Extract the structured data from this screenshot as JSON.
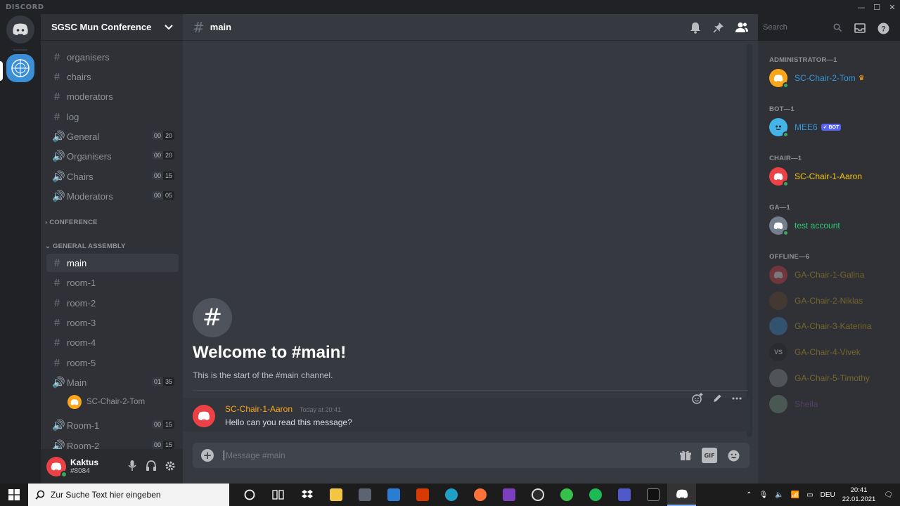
{
  "app": {
    "brand": "DISCORD"
  },
  "server": {
    "name": "SGSC Mun Conference"
  },
  "sidebar": {
    "channels_top": [
      {
        "label": "organisers",
        "type": "text"
      },
      {
        "label": "chairs",
        "type": "text"
      },
      {
        "label": "moderators",
        "type": "text"
      },
      {
        "label": "log",
        "type": "text"
      },
      {
        "label": "General",
        "type": "voice",
        "count_a": "00",
        "count_b": "20"
      },
      {
        "label": "Organisers",
        "type": "voice",
        "count_a": "00",
        "count_b": "20"
      },
      {
        "label": "Chairs",
        "type": "voice",
        "count_a": "00",
        "count_b": "15"
      },
      {
        "label": "Moderators",
        "type": "voice",
        "count_a": "00",
        "count_b": "05"
      }
    ],
    "category_conference": "CONFERENCE",
    "category_general_assembly": "GENERAL ASSEMBLY",
    "channels_ga": [
      {
        "label": "main",
        "type": "text",
        "active": true
      },
      {
        "label": "room-1",
        "type": "text"
      },
      {
        "label": "room-2",
        "type": "text"
      },
      {
        "label": "room-3",
        "type": "text"
      },
      {
        "label": "room-4",
        "type": "text"
      },
      {
        "label": "room-5",
        "type": "text"
      },
      {
        "label": "Main",
        "type": "voice",
        "count_a": "01",
        "count_b": "35"
      },
      {
        "label": "Room-1",
        "type": "voice",
        "count_a": "00",
        "count_b": "15"
      },
      {
        "label": "Room-2",
        "type": "voice",
        "count_a": "00",
        "count_b": "15"
      }
    ],
    "voice_user": "SC-Chair-2-Tom"
  },
  "user": {
    "name": "Kaktus",
    "tag": "#8084"
  },
  "chat": {
    "channel": "main",
    "welcome_title": "Welcome to #main!",
    "welcome_sub": "This is the start of the #main channel.",
    "message": {
      "author": "SC-Chair-1-Aaron",
      "time": "Today at 20:41",
      "text": "Hello can you read this message?"
    },
    "composer_placeholder": "Message #main"
  },
  "toolbar": {
    "search_placeholder": "Search",
    "gif_label": "GIF"
  },
  "members": {
    "roles": [
      {
        "label": "ADMINISTRATOR—1"
      },
      {
        "label": "BOT—1"
      },
      {
        "label": "CHAIR—1"
      },
      {
        "label": "GA—1"
      },
      {
        "label": "OFFLINE—6"
      }
    ],
    "online": [
      {
        "name": "SC-Chair-2-Tom",
        "color": "#3498db",
        "avatar": "#faa61a"
      },
      {
        "name": "MEE6",
        "color": "#3498db",
        "avatar": "#43b5e8",
        "badge": "✓ BOT"
      },
      {
        "name": "SC-Chair-1-Aaron",
        "color": "#f1c40f",
        "avatar": "#ed4245"
      },
      {
        "name": "test account",
        "color": "#2ecc71",
        "avatar": "#747f8d"
      }
    ],
    "offline": [
      {
        "name": "GA-Chair-1-Galina",
        "avatar": "#ed4245"
      },
      {
        "name": "GA-Chair-2-Niklas",
        "avatar": "#6b4a2b"
      },
      {
        "name": "GA-Chair-3-Katerina",
        "avatar": "#3a8fd6"
      },
      {
        "name": "GA-Chair-4-Vivek",
        "avatar": "#202225",
        "initials": "VS"
      },
      {
        "name": "GA-Chair-5-Timothy",
        "avatar": "#8e9297"
      },
      {
        "name": "Sheila",
        "avatar": "#7aa08a",
        "color": "#9b59b6"
      }
    ],
    "offline_color": "#f1c40f"
  },
  "taskbar": {
    "search_placeholder": "Zur Suche Text hier eingeben",
    "apps": [
      {
        "name": "cortana",
        "color": "#1c1c1c"
      },
      {
        "name": "task-view",
        "color": "#1c1c1c"
      },
      {
        "name": "dropbox",
        "color": "#0061fe"
      },
      {
        "name": "file-explorer",
        "color": "#f4c542"
      },
      {
        "name": "store",
        "color": "#5b6470"
      },
      {
        "name": "mail",
        "color": "#2b7cd3"
      },
      {
        "name": "office",
        "color": "#d83b01"
      },
      {
        "name": "edge",
        "color": "#1fa0c7"
      },
      {
        "name": "firefox",
        "color": "#ff7139"
      },
      {
        "name": "affinity",
        "color": "#7e3fbf"
      },
      {
        "name": "obs",
        "color": "#2b2b2b"
      },
      {
        "name": "app-green",
        "color": "#35c14a"
      },
      {
        "name": "spotify",
        "color": "#1db954"
      },
      {
        "name": "teams",
        "color": "#5059c9"
      },
      {
        "name": "terminal",
        "color": "#111111"
      },
      {
        "name": "discord",
        "color": "#5865f2"
      }
    ],
    "language": "DEU",
    "time": "20:41",
    "date": "22.01.2021"
  }
}
